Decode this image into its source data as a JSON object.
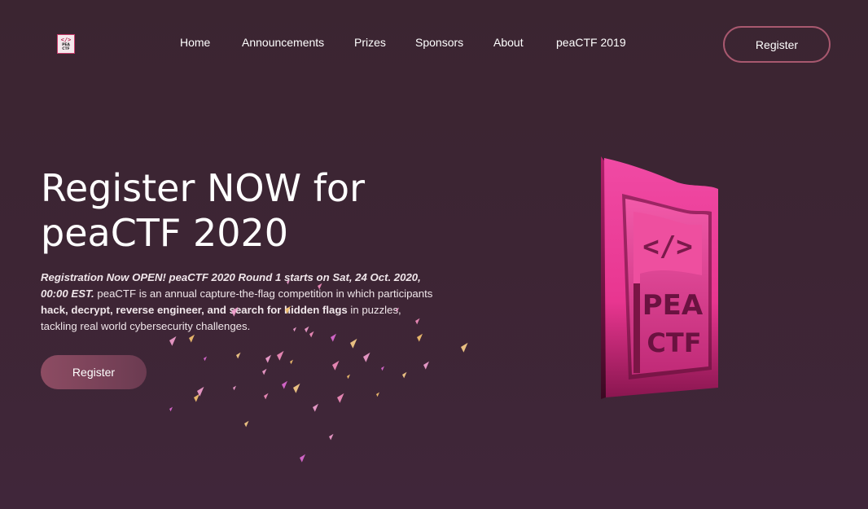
{
  "logo": {
    "tag": "</>",
    "text_line1": "PEA",
    "text_line2": "CTF"
  },
  "nav": {
    "items": [
      {
        "label": "Home"
      },
      {
        "label": "Announcements"
      },
      {
        "label": "Prizes"
      },
      {
        "label": "Sponsors"
      },
      {
        "label": "About"
      },
      {
        "label": "peaCTF 2019"
      }
    ],
    "register_label": "Register"
  },
  "hero": {
    "title_line1": "Register NOW for",
    "title_line2": "peaCTF 2020",
    "desc_emphasis": "Registration Now OPEN! peaCTF 2020 Round 1 starts on Sat, 24 Oct. 2020, 00:00 EST.",
    "desc_part1": " peaCTF is an annual capture-the-flag competition in which participants ",
    "desc_bold": "hack, decrypt, reverse engineer, and search for hidden flags",
    "desc_part2": " in puzzles, tackling real world cybersecurity challenges.",
    "register_label": "Register"
  },
  "flag_art": {
    "code_tag": "</>",
    "word1": "PEA",
    "word2": "CTF"
  },
  "colors": {
    "background": "#3d2534",
    "accent_pink": "#e8368f",
    "button": "#8d4c63",
    "outline": "#a8586f"
  }
}
